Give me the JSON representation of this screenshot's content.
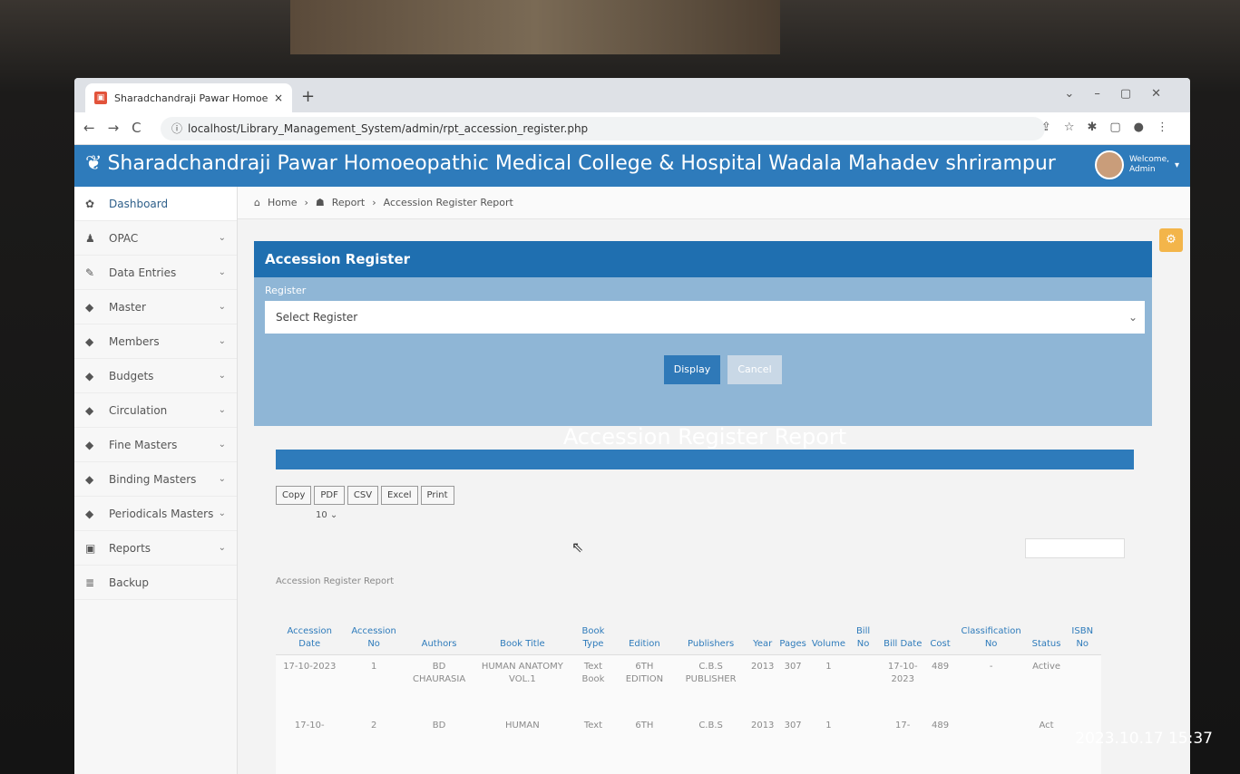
{
  "browser": {
    "tab_title": "Sharadchandraji Pawar Homoeo",
    "tab_close": "×",
    "new_tab": "+",
    "url_host": "localhost",
    "url_path": "/Library_Management_System/admin/rpt_accession_register.php"
  },
  "header": {
    "brand": "Sharadchandraji Pawar Homoeopathic Medical College & Hospital Wadala Mahadev shrirampur",
    "welcome_line1": "Welcome,",
    "welcome_line2": "Admin"
  },
  "sidebar": {
    "items": [
      {
        "label": "Dashboard",
        "icon": "dashboard-icon"
      },
      {
        "label": "OPAC",
        "icon": "user-icon"
      },
      {
        "label": "Data Entries",
        "icon": "pencil-icon"
      },
      {
        "label": "Master",
        "icon": "tag-icon"
      },
      {
        "label": "Members",
        "icon": "tag-icon"
      },
      {
        "label": "Budgets",
        "icon": "tag-icon"
      },
      {
        "label": "Circulation",
        "icon": "tag-icon"
      },
      {
        "label": "Fine Masters",
        "icon": "tag-icon"
      },
      {
        "label": "Binding Masters",
        "icon": "tag-icon"
      },
      {
        "label": "Periodicals Masters",
        "icon": "tag-icon"
      },
      {
        "label": "Reports",
        "icon": "reports-icon"
      },
      {
        "label": "Backup",
        "icon": "database-icon"
      }
    ]
  },
  "breadcrumb": {
    "home": "Home",
    "report": "Report",
    "current": "Accession Register Report"
  },
  "form": {
    "panel_title": "Accession Register",
    "register_label": "Register",
    "register_placeholder": "Select Register",
    "display_label": "Display",
    "cancel_label": "Cancel"
  },
  "report": {
    "title": "Accession Register Report",
    "export_buttons": [
      "Copy",
      "PDF",
      "CSV",
      "Excel",
      "Print"
    ],
    "page_length": "10",
    "caption": "Accession Register Report",
    "columns": [
      "Accession Date",
      "Accession No",
      "Authors",
      "Book Title",
      "Book Type",
      "Edition",
      "Publishers",
      "Year",
      "Pages",
      "Volume",
      "Bill No",
      "Bill Date",
      "Cost",
      "Classification No",
      "Status",
      "ISBN No"
    ],
    "rows": [
      [
        "17-10-2023",
        "1",
        "BD CHAURASIA",
        "HUMAN ANATOMY VOL.1",
        "Text Book",
        "6TH EDITION",
        "C.B.S PUBLISHER",
        "2013",
        "307",
        "1",
        "",
        "17-10-2023",
        "489",
        "-",
        "Active",
        ""
      ],
      [
        "17-10-",
        "2",
        "BD",
        "HUMAN",
        "Text",
        "6TH",
        "C.B.S",
        "2013",
        "307",
        "1",
        "",
        "17-",
        "489",
        "",
        "Act",
        ""
      ]
    ]
  },
  "photo_timestamp": "2023.10.17 15:37"
}
